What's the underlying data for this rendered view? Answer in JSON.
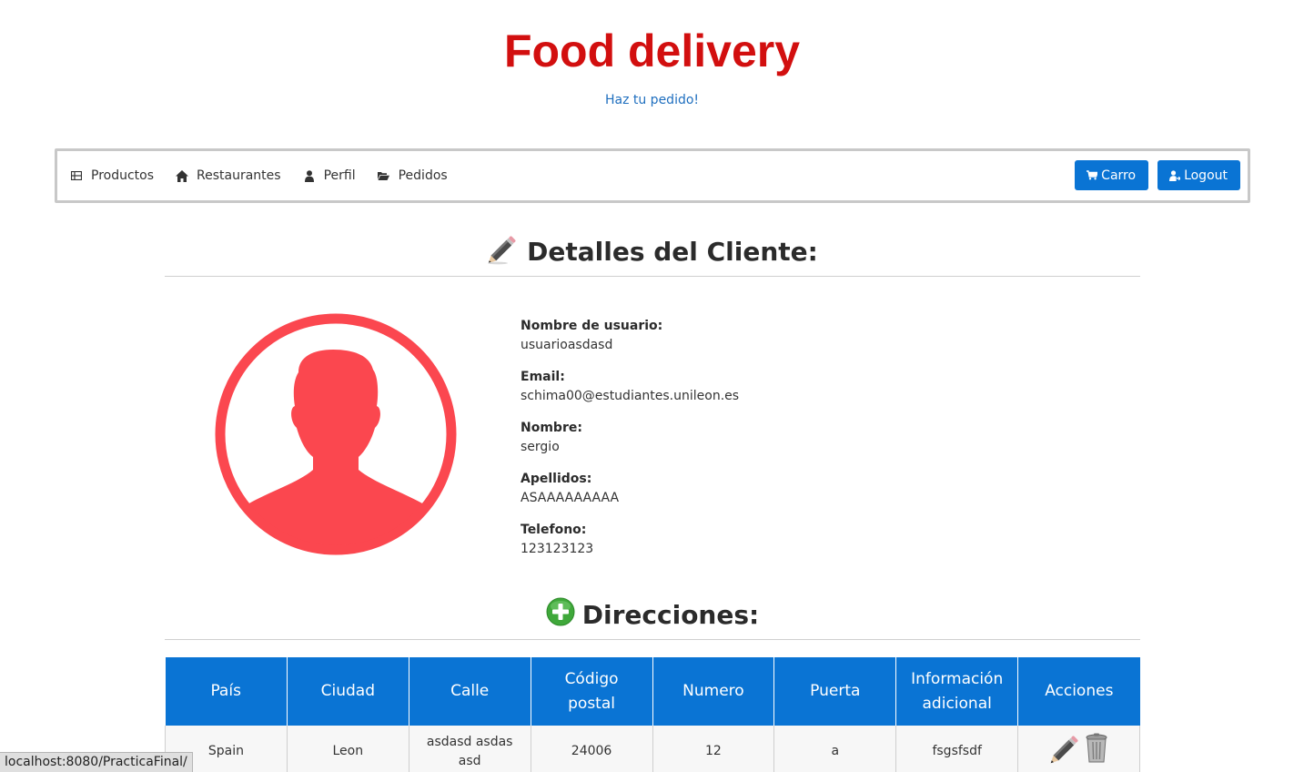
{
  "header": {
    "title": "Food delivery",
    "subtitle": "Haz tu pedido!"
  },
  "nav": {
    "items": [
      {
        "label": "Productos",
        "icon": "th-list-icon"
      },
      {
        "label": "Restaurantes",
        "icon": "home-icon"
      },
      {
        "label": "Perfil",
        "icon": "user-icon"
      },
      {
        "label": "Pedidos",
        "icon": "folder-open-icon"
      }
    ],
    "cart_label": "Carro",
    "logout_label": "Logout"
  },
  "client_section": {
    "title": "Detalles del Cliente:",
    "icon": "pencil-icon",
    "fields": [
      {
        "label": "Nombre de usuario:",
        "value": "usuarioasdasd"
      },
      {
        "label": "Email:",
        "value": "schima00@estudiantes.unileon.es"
      },
      {
        "label": "Nombre:",
        "value": "sergio"
      },
      {
        "label": "Apellidos:",
        "value": "ASAAAAAAAAA"
      },
      {
        "label": "Telefono:",
        "value": "123123123"
      }
    ]
  },
  "address_section": {
    "title": "Direcciones:",
    "icon": "add-circle-icon",
    "columns": [
      "País",
      "Ciudad",
      "Calle",
      "Código postal",
      "Numero",
      "Puerta",
      "Información adicional",
      "Acciones"
    ],
    "rows": [
      {
        "pais": "Spain",
        "ciudad": "Leon",
        "calle": "asdasd asdas asd",
        "cp": "24006",
        "numero": "12",
        "puerta": "a",
        "info": "fsgsfsdf"
      }
    ]
  },
  "status_bar": {
    "url": "localhost:8080/PracticaFinal/"
  },
  "colors": {
    "title_red": "#d20f0f",
    "primary_blue": "#0a74d4",
    "avatar_red": "#fb474f"
  }
}
